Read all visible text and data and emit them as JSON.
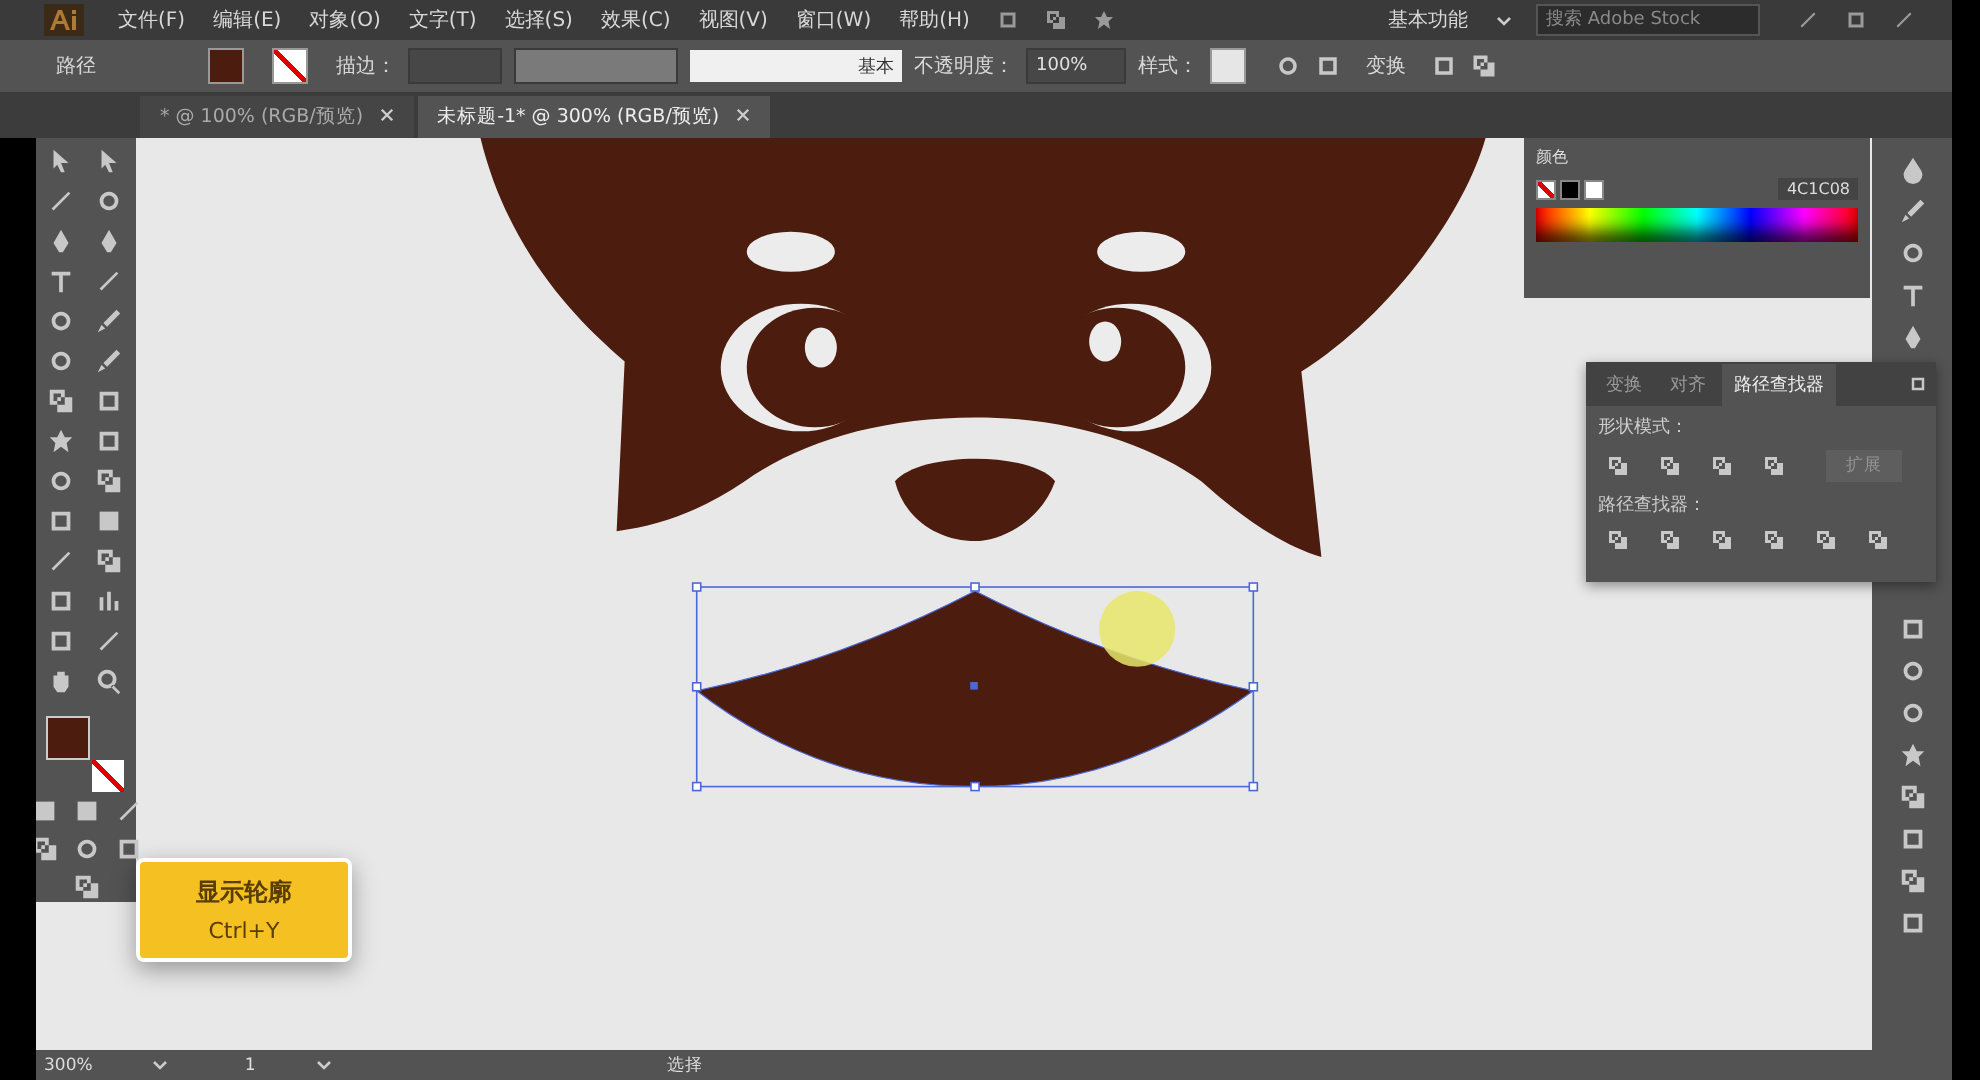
{
  "menu_bar": {
    "items": [
      "文件(F)",
      "编辑(E)",
      "对象(O)",
      "文字(T)",
      "选择(S)",
      "效果(C)",
      "视图(V)",
      "窗口(W)",
      "帮助(H)"
    ],
    "workspace": "基本功能",
    "search_placeholder": "搜索 Adobe Stock"
  },
  "control_bar": {
    "selection_label": "路径",
    "stroke_label": "描边：",
    "brush_label": "基本",
    "opacity_label": "不透明度：",
    "opacity_value": "100%",
    "style_label": "样式：",
    "transform_label": "变换"
  },
  "doc_tabs": [
    {
      "label": "* @ 100% (RGB/预览)",
      "selected": false
    },
    {
      "label": "未标题-1* @ 300% (RGB/预览)",
      "selected": true
    }
  ],
  "color_panel": {
    "tab": "颜色",
    "hex": "4C1C08"
  },
  "pathfinder_panel": {
    "tabs": [
      {
        "label": "变换",
        "selected": false
      },
      {
        "label": "对齐",
        "selected": false
      },
      {
        "label": "路径查找器",
        "selected": true
      }
    ],
    "shape_modes_label": "形状模式：",
    "expand_button": {
      "label": "扩展",
      "disabled": true
    },
    "pathfinders_label": "路径查找器："
  },
  "tooltip": {
    "title": "显示轮廓",
    "shortcut": "Ctrl+Y"
  },
  "status_bar": {
    "zoom": "300%",
    "artboard": "1",
    "tool": "选择"
  }
}
